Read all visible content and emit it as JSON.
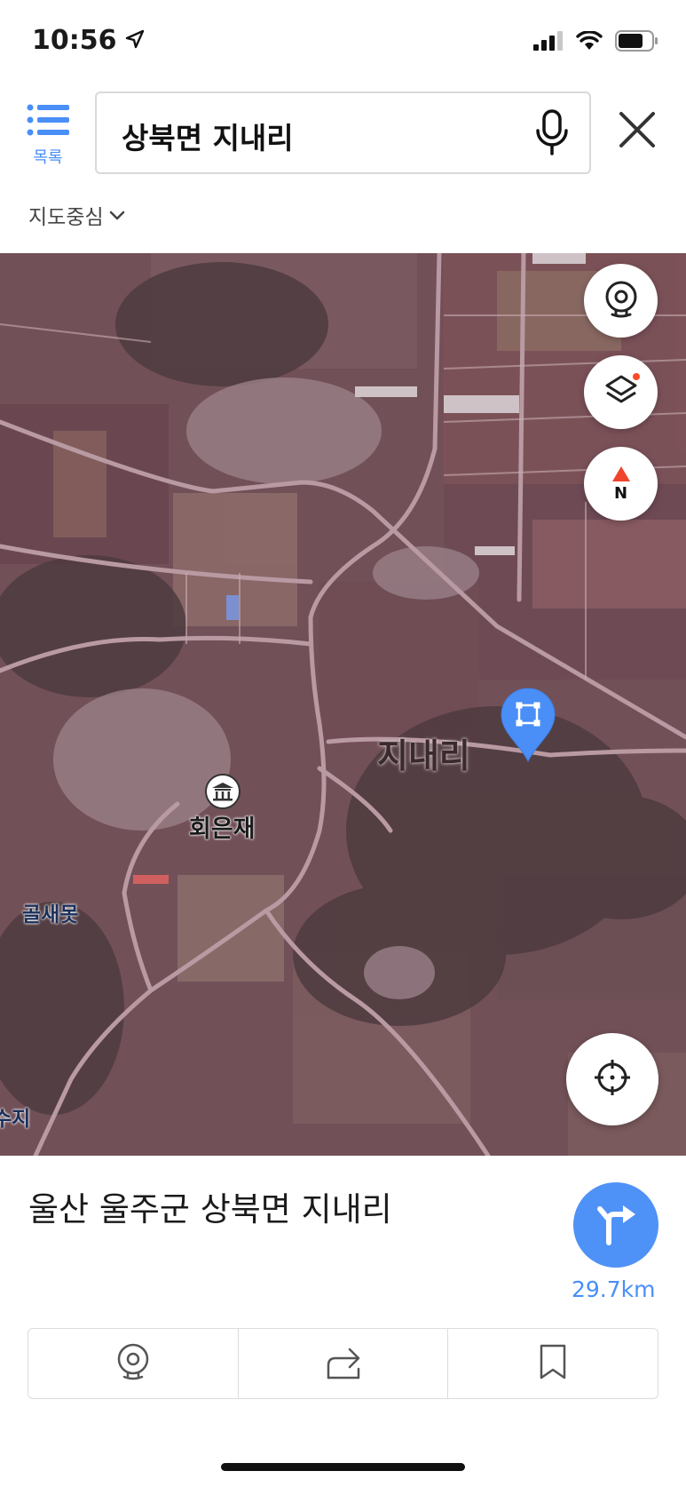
{
  "status_bar": {
    "time": "10:56"
  },
  "header": {
    "list_label": "목록",
    "search_query": "상북면 지내리",
    "center_dropdown_label": "지도중심"
  },
  "map": {
    "labels": {
      "village": "지내리",
      "poi": "회은재",
      "golsae": "골새못",
      "reservoir": "수지"
    }
  },
  "bottom": {
    "address": "울산 울주군 상북면 지내리",
    "distance": "29.7km"
  },
  "colors": {
    "accent": "#4f92f7",
    "link": "#4a8ff7",
    "pin": "#4a8ff7"
  }
}
